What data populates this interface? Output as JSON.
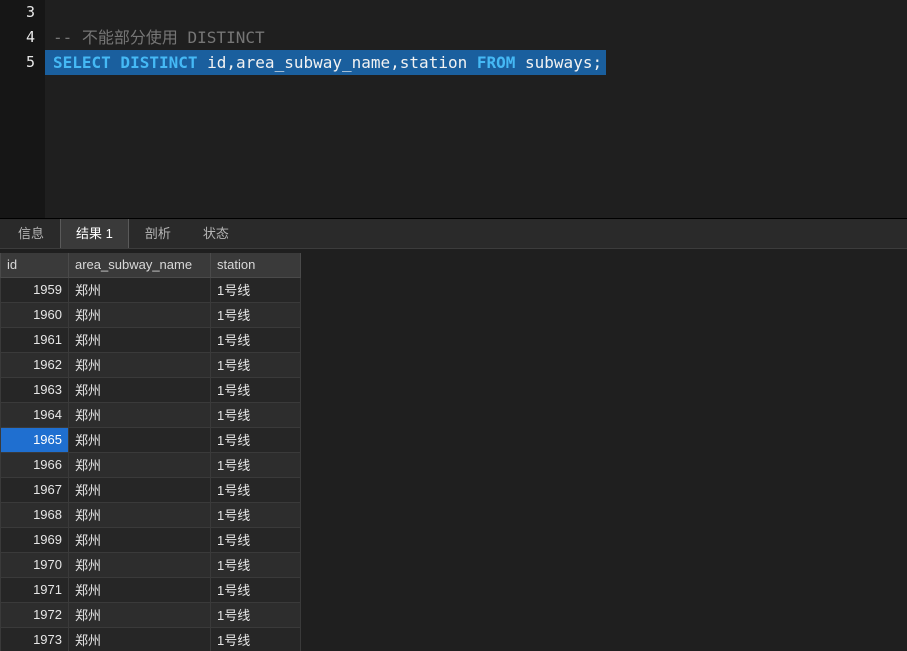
{
  "editor": {
    "line3": {
      "number": "3",
      "text": ""
    },
    "line4": {
      "number": "4",
      "comment": "-- 不能部分使用 DISTINCT"
    },
    "line5": {
      "number": "5",
      "kw1": "SELECT DISTINCT",
      "plain1": " id,area_subway_name,station ",
      "kw2": "FROM",
      "plain2": " subways;"
    }
  },
  "tabs": [
    {
      "label": "信息",
      "active": false
    },
    {
      "label": "结果 1",
      "active": true
    },
    {
      "label": "剖析",
      "active": false
    },
    {
      "label": "状态",
      "active": false
    }
  ],
  "table": {
    "columns": [
      "id",
      "area_subway_name",
      "station"
    ],
    "selected_id": "1965",
    "rows": [
      [
        "1959",
        "郑州",
        "1号线"
      ],
      [
        "1960",
        "郑州",
        "1号线"
      ],
      [
        "1961",
        "郑州",
        "1号线"
      ],
      [
        "1962",
        "郑州",
        "1号线"
      ],
      [
        "1963",
        "郑州",
        "1号线"
      ],
      [
        "1964",
        "郑州",
        "1号线"
      ],
      [
        "1965",
        "郑州",
        "1号线"
      ],
      [
        "1966",
        "郑州",
        "1号线"
      ],
      [
        "1967",
        "郑州",
        "1号线"
      ],
      [
        "1968",
        "郑州",
        "1号线"
      ],
      [
        "1969",
        "郑州",
        "1号线"
      ],
      [
        "1970",
        "郑州",
        "1号线"
      ],
      [
        "1971",
        "郑州",
        "1号线"
      ],
      [
        "1972",
        "郑州",
        "1号线"
      ],
      [
        "1973",
        "郑州",
        "1号线"
      ]
    ]
  },
  "colors": {
    "selection_bg": "#1a5f9e",
    "keyword": "#45b9f5",
    "comment": "#767676",
    "selected_cell_bg": "#1f6fd0",
    "editor_bg": "#1f1f1f",
    "gutter_bg": "#161616"
  }
}
